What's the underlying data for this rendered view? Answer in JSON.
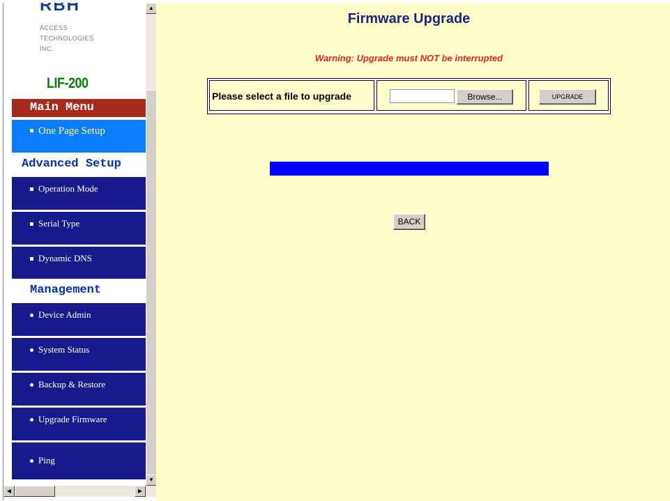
{
  "colors": {
    "content_background": "#ffffcc",
    "menu_item_background": "#181a8c",
    "menu_active_background": "#0a7cff",
    "menu_active_text": "#ffff60",
    "main_menu_header_background": "#a52a1a",
    "section_header_text": "#0033aa",
    "title_text": "#1a237e",
    "warning_text": "#ee2222",
    "device_name_text": "#0a7a0a",
    "progress_fill": "#0000ff"
  },
  "sidebar": {
    "logo": {
      "text": "RBH",
      "line1": "ACCESS",
      "line2": "TECHNOLOGIES",
      "line3": "INC."
    },
    "device_name": "LIF-200",
    "main_menu_header": "Main Menu",
    "one_page_setup": "One Page Setup",
    "advanced_header": "Advanced Setup",
    "advanced_items": [
      "Operation Mode",
      "Serial Type",
      "Dynamic DNS"
    ],
    "management_header": "Management",
    "management_items": [
      "Device Admin",
      "System Status",
      "Backup & Restore",
      "Upgrade Firmware",
      "Ping"
    ]
  },
  "main": {
    "title": "Firmware Upgrade",
    "warning": "Warning: Upgrade must NOT be interrupted",
    "file_label": "Please select a file to upgrade",
    "file_value": "",
    "browse_label": "Browse...",
    "upgrade_label": "UPGRADE",
    "progress_fraction": 1.0,
    "back_label": "BACK"
  },
  "icons": {
    "scroll_up": "triangle-up-icon",
    "scroll_down": "triangle-down-icon",
    "scroll_left": "triangle-left-icon",
    "scroll_right": "triangle-right-icon"
  }
}
